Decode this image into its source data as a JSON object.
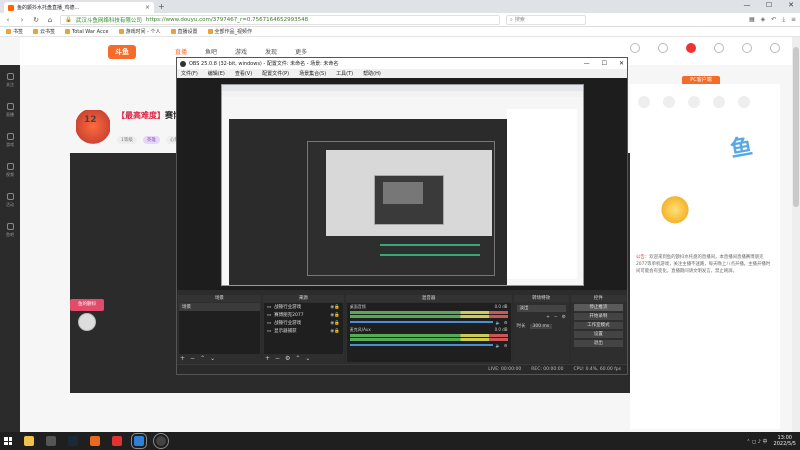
{
  "browser": {
    "tab_title": "鱼的颤抖水托盘直播_鸡德...",
    "tab_close": "×",
    "new_tab": "+",
    "win_min": "—",
    "win_max": "☐",
    "win_close": "✕",
    "nav_back": "‹",
    "nav_forward": "›",
    "nav_reload": "↻",
    "nav_home": "⌂",
    "site_name": "武汉斗鱼网络科技有限公司",
    "url": "https://www.douyu.com/3797467_r=0.7567164652993548",
    "search_placeholder": "搜索",
    "bookmarks": [
      "书签",
      "云书签",
      "Total War Acce",
      "游戏时间 - 个人",
      "直播设置",
      "全部作品_视频作"
    ]
  },
  "page": {
    "logo": "斗鱼",
    "nav": [
      "直播",
      "鱼吧",
      "游戏",
      "发现",
      "更多"
    ],
    "viewer_count": "12",
    "room_title_prefix": "【最高难度】",
    "room_title": "赛博朋克",
    "chips": [
      "1等级",
      "英雄",
      "心怀"
    ],
    "pc_button": "PC客户端",
    "rail_items": [
      "关注",
      "直播",
      "游戏",
      "视频",
      "活动",
      "鱼吧"
    ],
    "right_note_red": "公告：",
    "right_note": "欢迎来到鱼的颤抖水托盘的直播间，本直播间直播赛博朋克2077等单机游戏，关注主播不迷路，每天晚上八点开播。主播开播时间可能会有变化，直播期间请文明发言，禁止刷屏。",
    "right_big": "鱼",
    "badge_text": "鱼的颤抖"
  },
  "obs": {
    "title": "OBS 25.0.8 (32-bit, windows) - 配置文件: 未命名 - 场景: 未命名",
    "menu": [
      "文件(F)",
      "编辑(E)",
      "查看(V)",
      "配置文件(P)",
      "场景集合(S)",
      "工具(T)",
      "帮助(H)"
    ],
    "docks": {
      "scenes_title": "场景",
      "sources_title": "来源",
      "mixer_title": "混音器",
      "transitions_title": "转场特效",
      "controls_title": "控件"
    },
    "scenes": [
      "场景"
    ],
    "sources": [
      "战锤行业游戏",
      "赛博朋克2077",
      "战锤行业游戏",
      "显示器捕获"
    ],
    "mixer": [
      {
        "name": "桌面音频",
        "value": "0.0 dB"
      },
      {
        "name": "麦克风/Aux",
        "value": "0.0 dB"
      }
    ],
    "transition_select": "淡出",
    "duration_label": "时长",
    "duration_value": "300 ms",
    "controls": [
      "停止推流",
      "开始录制",
      "工作室模式",
      "设置",
      "退出"
    ],
    "status": {
      "live": "LIVE: 00:00:00",
      "rec": "REC: 00:00:00",
      "cpu": "CPU: 0.4%, 60.00 fps"
    }
  },
  "taskbar": {
    "time": "13:00",
    "date": "2022/5/5",
    "tray": "⌃ ◻ ♪ 中"
  }
}
